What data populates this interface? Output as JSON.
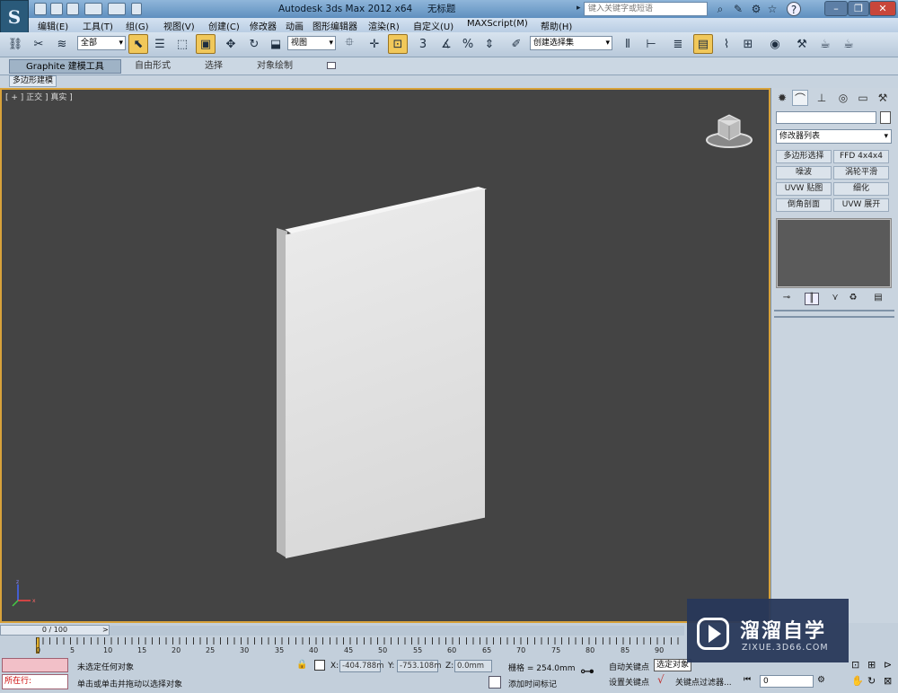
{
  "window": {
    "app_title": "Autodesk 3ds Max  2012 x64",
    "doc_title": "无标题",
    "search_placeholder": "键入关键字或短语",
    "help": "?"
  },
  "menu": [
    "编辑(E)",
    "工具(T)",
    "组(G)",
    "视图(V)",
    "创建(C)",
    "修改器",
    "动画",
    "图形编辑器",
    "渲染(R)",
    "自定义(U)",
    "MAXScript(M)",
    "帮助(H)"
  ],
  "toolbar": {
    "filter": "全部",
    "refcoord": "视图",
    "snap_label": "3",
    "named_selection": "创建选择集"
  },
  "ribbon": {
    "tabs": [
      "Graphite 建模工具",
      "自由形式",
      "选择",
      "对象绘制"
    ],
    "subtab": "多边形建模"
  },
  "viewport": {
    "label": "[ + ] 正交 ] 真实 ]"
  },
  "command_panel": {
    "modifier_list": "修改器列表",
    "buttons": [
      "多边形选择",
      "FFD 4x4x4",
      "噪波",
      "涡轮平滑",
      "UVW 贴图",
      "细化",
      "倒角剖面",
      "UVW 展开"
    ]
  },
  "timeline": {
    "slider": "0 / 100",
    "ticks": [
      "0",
      "5",
      "10",
      "15",
      "20",
      "25",
      "30",
      "35",
      "40",
      "45",
      "50",
      "55",
      "60",
      "65",
      "70",
      "75",
      "80",
      "85",
      "90"
    ]
  },
  "status": {
    "script_label": "所在行:",
    "selected": "未选定任何对象",
    "prompt": "单击或单击并拖动以选择对象",
    "x_label": "X:",
    "x": "-404.788m",
    "y_label": "Y:",
    "y": "-753.108m",
    "z_label": "Z:",
    "z": "0.0mm",
    "grid": "栅格 = 254.0mm",
    "auto_key": "自动关键点",
    "selected_obj": "选定对象",
    "set_key": "设置关键点",
    "key_filters": "关键点过滤器...",
    "add_time_tag": "添加时间标记",
    "frame": "0"
  },
  "watermark": {
    "main": "溜溜自学",
    "sub": "ZIXUE.3D66.COM"
  },
  "colors": {
    "viewport_bg": "#444444",
    "viewport_border": "#d8a23a",
    "object": "#e0e0e0"
  }
}
